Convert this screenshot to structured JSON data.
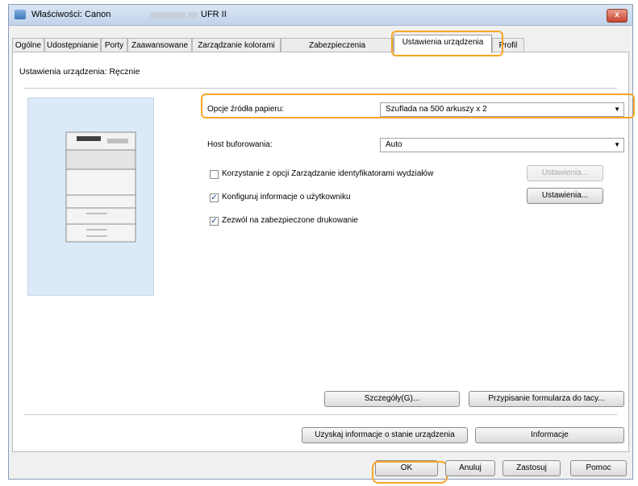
{
  "window": {
    "title": "Właściwości: Canon",
    "title_suffix": "UFR II",
    "close_label": "x"
  },
  "tabs": [
    "Ogólne",
    "Udostępnianie",
    "Porty",
    "Zaawansowane",
    "Zarządzanie kolorami",
    "Zabezpieczenia",
    "Ustawienia urządzenia",
    "Profil"
  ],
  "active_tab": "Ustawienia urządzenia",
  "panel": {
    "mode_label": "Ustawienia urządzenia: Ręcznie",
    "paper_source": {
      "label": "Opcje źródła papieru:",
      "value": "Szuflada na 500 arkuszy x 2"
    },
    "spooling": {
      "label": "Host buforowania:",
      "value": "Auto"
    },
    "checkboxes": [
      {
        "label": "Korzystanie z opcji Zarządzanie identyfikatorami wydziałów",
        "checked": false
      },
      {
        "label": "Konfiguruj informacje o użytkowniku",
        "checked": true
      },
      {
        "label": "Zezwól na zabezpieczone drukowanie",
        "checked": true
      }
    ],
    "settings_buttons": [
      "Ustawienia...",
      "Ustawienia..."
    ],
    "details_button": "Szczegóły(G)...",
    "form_assign_button": "Przypisanie formularza do tacy...",
    "device_status_button": "Uzyskaj informacje o stanie urządzenia",
    "info_button": "Informacje"
  },
  "footer": {
    "ok": "OK",
    "cancel": "Anuluj",
    "apply": "Zastosuj",
    "help": "Pomoc"
  }
}
